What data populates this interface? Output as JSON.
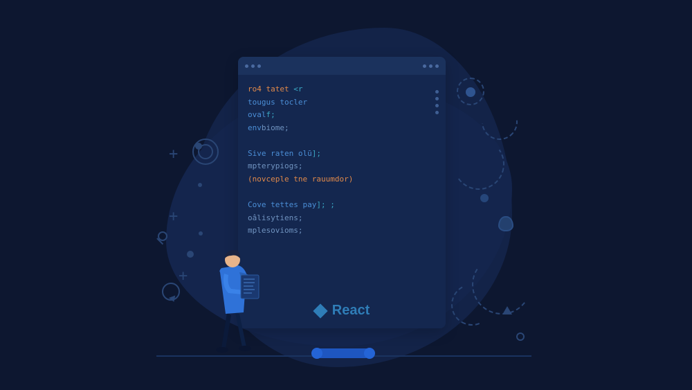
{
  "editor": {
    "lines": [
      {
        "seg1": "ro4 tatet ",
        "seg2": "<",
        "seg3": "r",
        "cls1": "c-orange",
        "cls2": "c-teal",
        "cls3": "c-teal"
      },
      {
        "seg1": "tougus tocler",
        "cls1": "c-blue"
      },
      {
        "seg1": "oval",
        "seg2": "f;",
        "cls1": "c-blue",
        "cls2": "c-teal"
      },
      {
        "seg1": "env",
        "seg2": "biome;",
        "cls1": "c-blue",
        "cls2": "c-dim"
      }
    ],
    "lines2": [
      {
        "seg1": "Sive raten olū",
        "seg2": "];",
        "cls1": "c-blue",
        "cls2": "c-teal"
      },
      {
        "seg1": "mpterypiogs;",
        "cls1": "c-dim"
      },
      {
        "seg1": "(novceple tne rauumdor)",
        "cls1": "c-orange"
      }
    ],
    "lines3": [
      {
        "seg1": "Cove tettes pay",
        "seg2": "]; ;",
        "cls1": "c-blue",
        "cls2": "c-teal"
      },
      {
        "seg1": "oâlisytiens;",
        "cls1": "c-dim"
      },
      {
        "seg1": "mplesovioms;",
        "cls1": "c-dim"
      }
    ]
  },
  "brand": {
    "label": "React"
  }
}
